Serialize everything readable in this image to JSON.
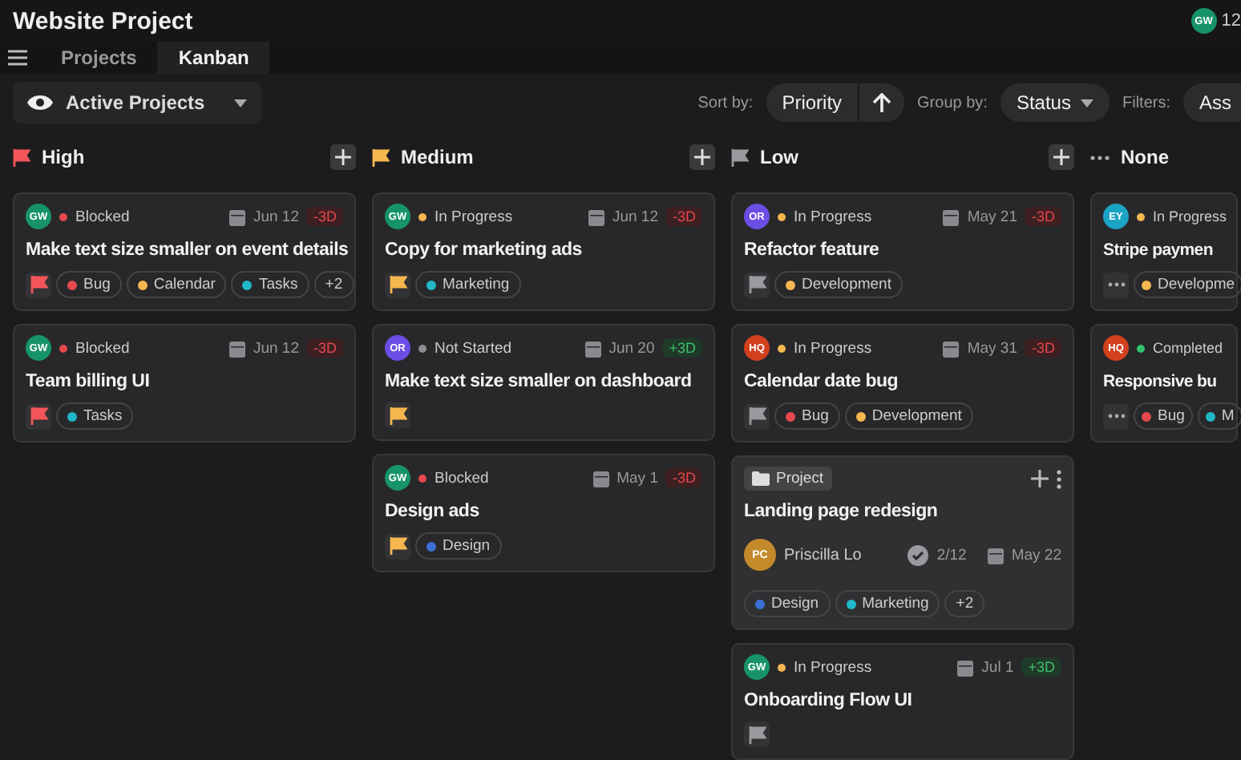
{
  "header": {
    "title": "Website Project",
    "user": {
      "initials": "GW",
      "color": "#17936b",
      "count": "12"
    }
  },
  "tabs": [
    {
      "label": "Projects",
      "selected": false
    },
    {
      "label": "Kanban",
      "selected": true
    }
  ],
  "toolbar": {
    "view": "Active Projects",
    "sort_label": "Sort by:",
    "sort_value": "Priority",
    "group_label": "Group by:",
    "group_value": "Status",
    "filters_label": "Filters:",
    "filter_chip": "Ass"
  },
  "columns": [
    {
      "title": "High",
      "kind": "high",
      "add_button": true,
      "cards": [
        {
          "kind": "task",
          "avatar": {
            "initials": "GW",
            "color": "#17936b"
          },
          "status": {
            "label": "Blocked",
            "color": "#e5484d"
          },
          "date": "Jun 12",
          "due": {
            "label": "-3D",
            "kind": "overdue"
          },
          "title": "Make text size smaller on event details",
          "tags": [
            {
              "label": "Bug",
              "color": "#e5484d"
            },
            {
              "label": "Calendar",
              "color": "#f5b74f"
            },
            {
              "label": "Tasks",
              "color": "#20b8c8"
            }
          ],
          "more": "+2"
        },
        {
          "kind": "task",
          "avatar": {
            "initials": "GW",
            "color": "#17936b"
          },
          "status": {
            "label": "Blocked",
            "color": "#e5484d"
          },
          "date": "Jun 12",
          "due": {
            "label": "-3D",
            "kind": "overdue"
          },
          "title": "Team billing UI",
          "tags": [
            {
              "label": "Tasks",
              "color": "#20b8c8"
            }
          ]
        }
      ]
    },
    {
      "title": "Medium",
      "kind": "medium",
      "add_button": true,
      "cards": [
        {
          "kind": "task",
          "avatar": {
            "initials": "GW",
            "color": "#17936b"
          },
          "status": {
            "label": "In Progress",
            "color": "#f5b74f"
          },
          "date": "Jun 12",
          "due": {
            "label": "-3D",
            "kind": "overdue"
          },
          "title": "Copy for marketing ads",
          "tags": [
            {
              "label": "Marketing",
              "color": "#20b8c8"
            }
          ]
        },
        {
          "kind": "task",
          "avatar": {
            "initials": "OR",
            "color": "#6b4ee6"
          },
          "status": {
            "label": "Not Started",
            "color": "#8e8e93"
          },
          "date": "Jun 20",
          "due": {
            "label": "+3D",
            "kind": "ahead"
          },
          "title": "Make text size smaller on dashboard"
        },
        {
          "kind": "task",
          "avatar": {
            "initials": "GW",
            "color": "#17936b"
          },
          "status": {
            "label": "Blocked",
            "color": "#e5484d"
          },
          "date": "May 1",
          "due": {
            "label": "-3D",
            "kind": "overdue"
          },
          "title": "Design ads",
          "tags": [
            {
              "label": "Design",
              "color": "#3b6fd6"
            }
          ]
        }
      ]
    },
    {
      "title": "Low",
      "kind": "low",
      "add_button": true,
      "cards": [
        {
          "kind": "task",
          "avatar": {
            "initials": "OR",
            "color": "#6b4ee6"
          },
          "status": {
            "label": "In Progress",
            "color": "#f5b74f"
          },
          "date": "May 21",
          "due": {
            "label": "-3D",
            "kind": "overdue"
          },
          "title": "Refactor feature",
          "tags": [
            {
              "label": "Development",
              "color": "#f5b74f"
            }
          ]
        },
        {
          "kind": "task",
          "avatar": {
            "initials": "HQ",
            "color": "#d2401e"
          },
          "status": {
            "label": "In Progress",
            "color": "#f5b74f"
          },
          "date": "May 31",
          "due": {
            "label": "-3D",
            "kind": "overdue"
          },
          "title": "Calendar date bug",
          "tags": [
            {
              "label": "Bug",
              "color": "#e5484d"
            },
            {
              "label": "Development",
              "color": "#f5b74f"
            }
          ]
        },
        {
          "kind": "project",
          "badge": "Project",
          "title": "Landing page redesign",
          "owner": {
            "initials": "PC",
            "name": "Priscilla Lo",
            "color": "#c48a2a"
          },
          "progress": "2/12",
          "date": "May 22",
          "tags": [
            {
              "label": "Design",
              "color": "#3b6fd6"
            },
            {
              "label": "Marketing",
              "color": "#20b8c8"
            }
          ],
          "more": "+2"
        },
        {
          "kind": "task",
          "avatar": {
            "initials": "GW",
            "color": "#17936b"
          },
          "status": {
            "label": "In Progress",
            "color": "#f5b74f"
          },
          "date": "Jul 1",
          "due": {
            "label": "+3D",
            "kind": "ahead"
          },
          "title": "Onboarding Flow UI"
        }
      ]
    },
    {
      "title": "None",
      "kind": "none",
      "add_button": false,
      "cards": [
        {
          "kind": "task",
          "avatar": {
            "initials": "EY",
            "color": "#1aa3c4"
          },
          "status": {
            "label": "In Progress",
            "color": "#f5b74f"
          },
          "title": "Stripe paymen",
          "tags": [
            {
              "label": "Developme",
              "color": "#f5b74f"
            }
          ]
        },
        {
          "kind": "task",
          "avatar": {
            "initials": "HQ",
            "color": "#d2401e"
          },
          "status": {
            "label": "Completed",
            "color": "#30c46a"
          },
          "title": "Responsive bu",
          "tags": [
            {
              "label": "Bug",
              "color": "#e5484d"
            },
            {
              "label": "M",
              "color": "#20b8c8"
            }
          ]
        }
      ]
    }
  ]
}
